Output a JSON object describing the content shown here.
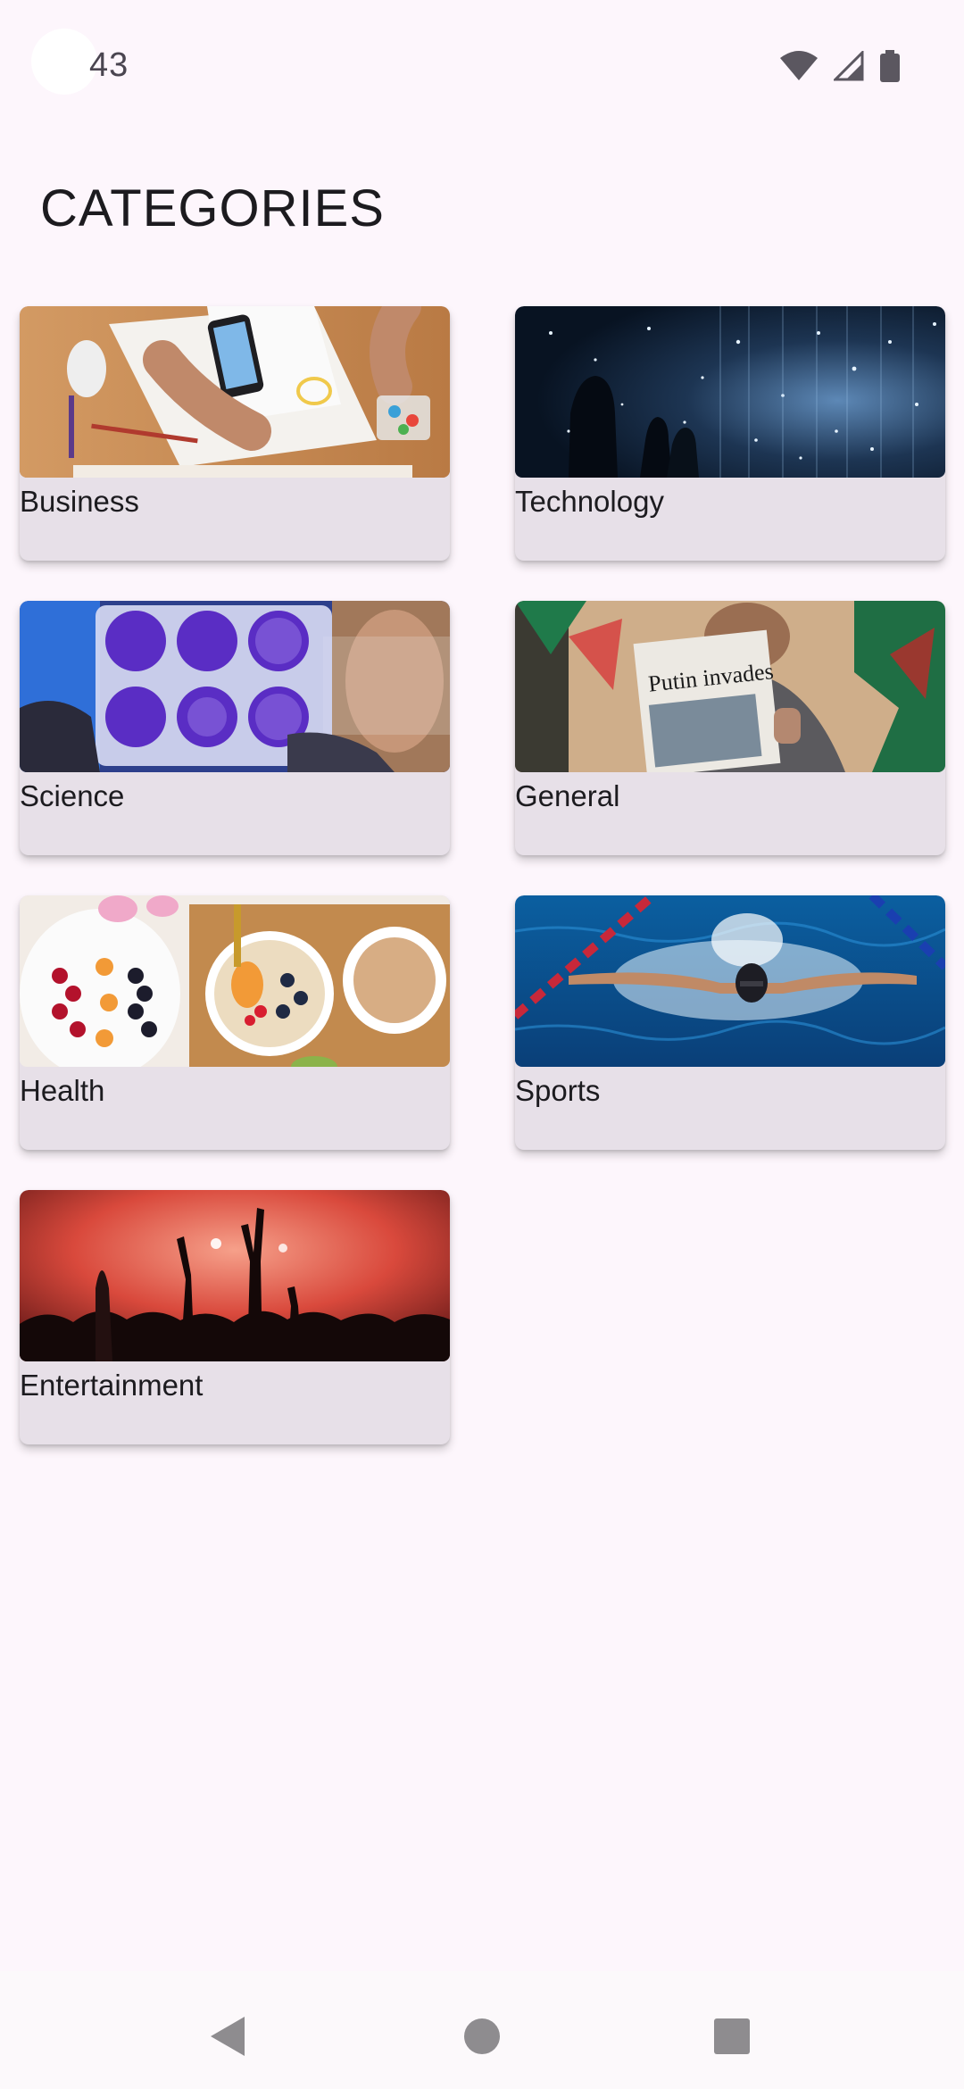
{
  "status_bar": {
    "time": "43",
    "icons": [
      "wifi-icon",
      "signal-icon",
      "battery-icon"
    ]
  },
  "page": {
    "title": "CATEGORIES"
  },
  "categories": [
    {
      "label": "Business",
      "image": "business-desk-photo"
    },
    {
      "label": "Technology",
      "image": "technology-lights-photo"
    },
    {
      "label": "Science",
      "image": "science-lab-photo"
    },
    {
      "label": "General",
      "image": "newspaper-reader-photo"
    },
    {
      "label": "Health",
      "image": "healthy-food-photo"
    },
    {
      "label": "Sports",
      "image": "swimmer-photo"
    },
    {
      "label": "Entertainment",
      "image": "concert-crowd-photo"
    }
  ],
  "nav_bar": {
    "icons": [
      "back-icon",
      "home-icon",
      "recents-icon"
    ]
  },
  "colors": {
    "background": "#fdf6fc",
    "card": "#e7e0e8",
    "text": "#1c1b1f",
    "nav_icon": "#8e8c8f"
  }
}
